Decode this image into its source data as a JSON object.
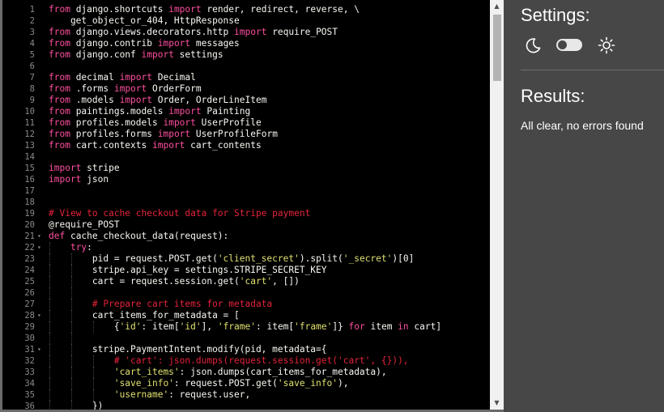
{
  "editor": {
    "lines": [
      {
        "n": "1",
        "fold": false,
        "indent": 0,
        "html": "<span class='kw'>from</span> django.shortcuts <span class='kw'>import</span> render, redirect, reverse, \\"
      },
      {
        "n": "2",
        "fold": false,
        "indent": 0,
        "html": "    get_object_or_404, HttpResponse"
      },
      {
        "n": "3",
        "fold": false,
        "indent": 0,
        "html": "<span class='kw'>from</span> django.views.decorators.http <span class='kw'>import</span> require_POST"
      },
      {
        "n": "4",
        "fold": false,
        "indent": 0,
        "html": "<span class='kw'>from</span> django.contrib <span class='kw'>import</span> messages"
      },
      {
        "n": "5",
        "fold": false,
        "indent": 0,
        "html": "<span class='kw'>from</span> django.conf <span class='kw'>import</span> settings"
      },
      {
        "n": "6",
        "fold": false,
        "indent": 0,
        "html": ""
      },
      {
        "n": "7",
        "fold": false,
        "indent": 0,
        "html": "<span class='kw'>from</span> decimal <span class='kw'>import</span> Decimal"
      },
      {
        "n": "8",
        "fold": false,
        "indent": 0,
        "html": "<span class='kw'>from</span> .forms <span class='kw'>import</span> OrderForm"
      },
      {
        "n": "9",
        "fold": false,
        "indent": 0,
        "html": "<span class='kw'>from</span> .models <span class='kw'>import</span> Order, OrderLineItem"
      },
      {
        "n": "10",
        "fold": false,
        "indent": 0,
        "html": "<span class='kw'>from</span> paintings.models <span class='kw'>import</span> Painting"
      },
      {
        "n": "11",
        "fold": false,
        "indent": 0,
        "html": "<span class='kw'>from</span> profiles.models <span class='kw'>import</span> UserProfile"
      },
      {
        "n": "12",
        "fold": false,
        "indent": 0,
        "html": "<span class='kw'>from</span> profiles.forms <span class='kw'>import</span> UserProfileForm"
      },
      {
        "n": "13",
        "fold": false,
        "indent": 0,
        "html": "<span class='kw'>from</span> cart.contexts <span class='kw'>import</span> cart_contents"
      },
      {
        "n": "14",
        "fold": false,
        "indent": 0,
        "html": ""
      },
      {
        "n": "15",
        "fold": false,
        "indent": 0,
        "html": "<span class='kw'>import</span> stripe"
      },
      {
        "n": "16",
        "fold": false,
        "indent": 0,
        "html": "<span class='kw'>import</span> json"
      },
      {
        "n": "17",
        "fold": false,
        "indent": 0,
        "html": ""
      },
      {
        "n": "18",
        "fold": false,
        "indent": 0,
        "html": ""
      },
      {
        "n": "19",
        "fold": false,
        "indent": 0,
        "html": "<span class='cm'># View to cache checkout data for Stripe payment</span>"
      },
      {
        "n": "20",
        "fold": false,
        "indent": 0,
        "html": "@require_POST"
      },
      {
        "n": "21",
        "fold": true,
        "indent": 0,
        "html": "<span class='kw'>def</span> cache_checkout_data(request):"
      },
      {
        "n": "22",
        "fold": true,
        "indent": 1,
        "html": "    <span class='kw'>try</span>:"
      },
      {
        "n": "23",
        "fold": false,
        "indent": 2,
        "html": "        pid = request.POST.get(<span class='st'>'client_secret'</span>).split(<span class='st'>'_secret'</span>)[0]"
      },
      {
        "n": "24",
        "fold": false,
        "indent": 2,
        "html": "        stripe.api_key = settings.STRIPE_SECRET_KEY"
      },
      {
        "n": "25",
        "fold": false,
        "indent": 2,
        "html": "        cart = request.session.get(<span class='st'>'cart'</span>, [])"
      },
      {
        "n": "26",
        "fold": false,
        "indent": 2,
        "html": ""
      },
      {
        "n": "27",
        "fold": false,
        "indent": 2,
        "html": "        <span class='cm'># Prepare cart items for metadata</span>"
      },
      {
        "n": "28",
        "fold": true,
        "indent": 2,
        "html": "        cart_items_for_metadata = ["
      },
      {
        "n": "29",
        "fold": false,
        "indent": 3,
        "html": "            {<span class='st'>'id'</span>: item[<span class='st'>'id'</span>], <span class='st'>'frame'</span>: item[<span class='st'>'frame'</span>]} <span class='kw'>for</span> item <span class='kw'>in</span> cart]"
      },
      {
        "n": "30",
        "fold": false,
        "indent": 2,
        "html": ""
      },
      {
        "n": "31",
        "fold": true,
        "indent": 2,
        "html": "        stripe.PaymentIntent.modify(pid, metadata={"
      },
      {
        "n": "32",
        "fold": false,
        "indent": 3,
        "html": "            <span class='cm'># 'cart': json.dumps(request.session.get('cart', {})),</span>"
      },
      {
        "n": "33",
        "fold": false,
        "indent": 3,
        "html": "            <span class='st'>'cart_items'</span>: json.dumps(cart_items_for_metadata),"
      },
      {
        "n": "34",
        "fold": false,
        "indent": 3,
        "html": "            <span class='st'>'save_info'</span>: request.POST.get(<span class='st'>'save_info'</span>),"
      },
      {
        "n": "35",
        "fold": false,
        "indent": 3,
        "html": "            <span class='st'>'username'</span>: request.user,"
      },
      {
        "n": "36",
        "fold": false,
        "indent": 2,
        "html": "        })"
      }
    ]
  },
  "panel": {
    "settings_title": "Settings:",
    "results_title": "Results:",
    "results_text": "All clear, no errors found"
  },
  "icons": {
    "dark_mode": "moon-icon",
    "light_mode": "sun-icon",
    "scroll_up": "arrow-up-icon",
    "scroll_down": "arrow-down-icon"
  },
  "colors": {
    "keyword": "#ff4fa0",
    "comment": "#e4233a",
    "string": "#e0e070",
    "panel_bg": "#474747"
  }
}
